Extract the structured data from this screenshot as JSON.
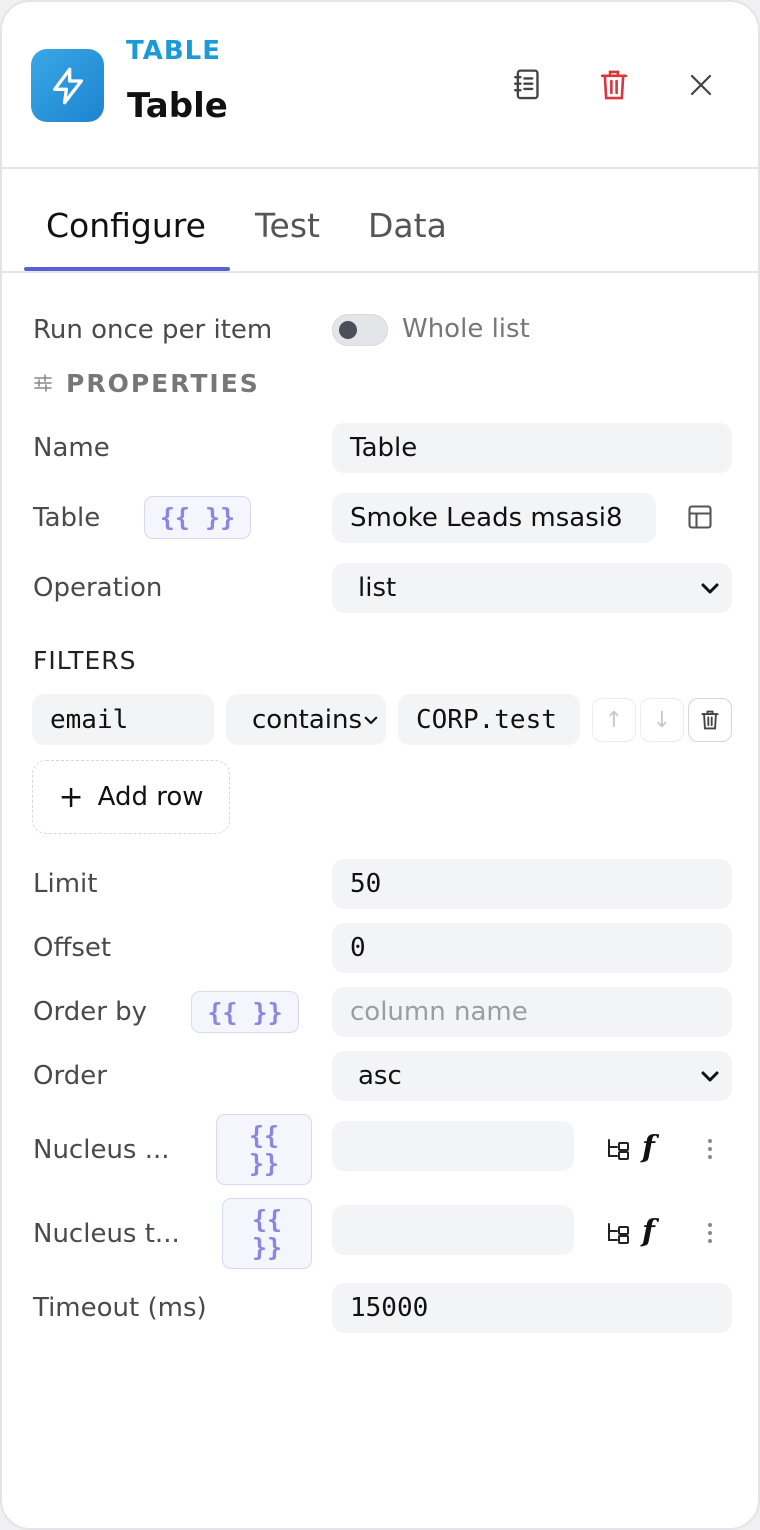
{
  "header": {
    "kicker": "TABLE",
    "title": "Table",
    "icons": {
      "app": "bolt-icon",
      "docs": "notebook-icon",
      "delete": "trash-icon",
      "close": "close-icon"
    }
  },
  "tabs": [
    {
      "label": "Configure",
      "active": true
    },
    {
      "label": "Test",
      "active": false
    },
    {
      "label": "Data",
      "active": false
    }
  ],
  "run_mode": {
    "label": "Run once per item",
    "toggle_label": "Whole list",
    "enabled": false
  },
  "properties_title": "PROPERTIES",
  "fields": {
    "name": {
      "label": "Name",
      "value": "Table"
    },
    "table": {
      "label": "Table",
      "expr": "{{ }}",
      "value": "Smoke Leads msasi8"
    },
    "operation": {
      "label": "Operation",
      "value": "list"
    }
  },
  "filters": {
    "title": "FILTERS",
    "row": {
      "field": "email",
      "operator": "contains",
      "value": "CORP.test"
    },
    "move_up": "↑",
    "move_down": "↓",
    "add_row": "Add row",
    "add_icon": "+"
  },
  "options": {
    "limit": {
      "label": "Limit",
      "value": "50"
    },
    "offset": {
      "label": "Offset",
      "value": "0"
    },
    "order_by": {
      "label": "Order by",
      "expr": "{{ }}",
      "placeholder": "column name"
    },
    "order": {
      "label": "Order",
      "value": "asc"
    },
    "nucleus_1": {
      "label": "Nucleus ...",
      "expr_top": "{{",
      "expr_bottom": "}}",
      "value": ""
    },
    "nucleus_2": {
      "label": "Nucleus t...",
      "expr_top": "{{",
      "expr_bottom": "}}",
      "value": ""
    },
    "timeout": {
      "label": "Timeout (ms)",
      "value": "15000"
    },
    "fx_label": "f"
  },
  "colors": {
    "accent": "#5b5fd6",
    "brand": "#1a9ad8",
    "danger": "#d9363e",
    "expr": "#8d86e0"
  }
}
